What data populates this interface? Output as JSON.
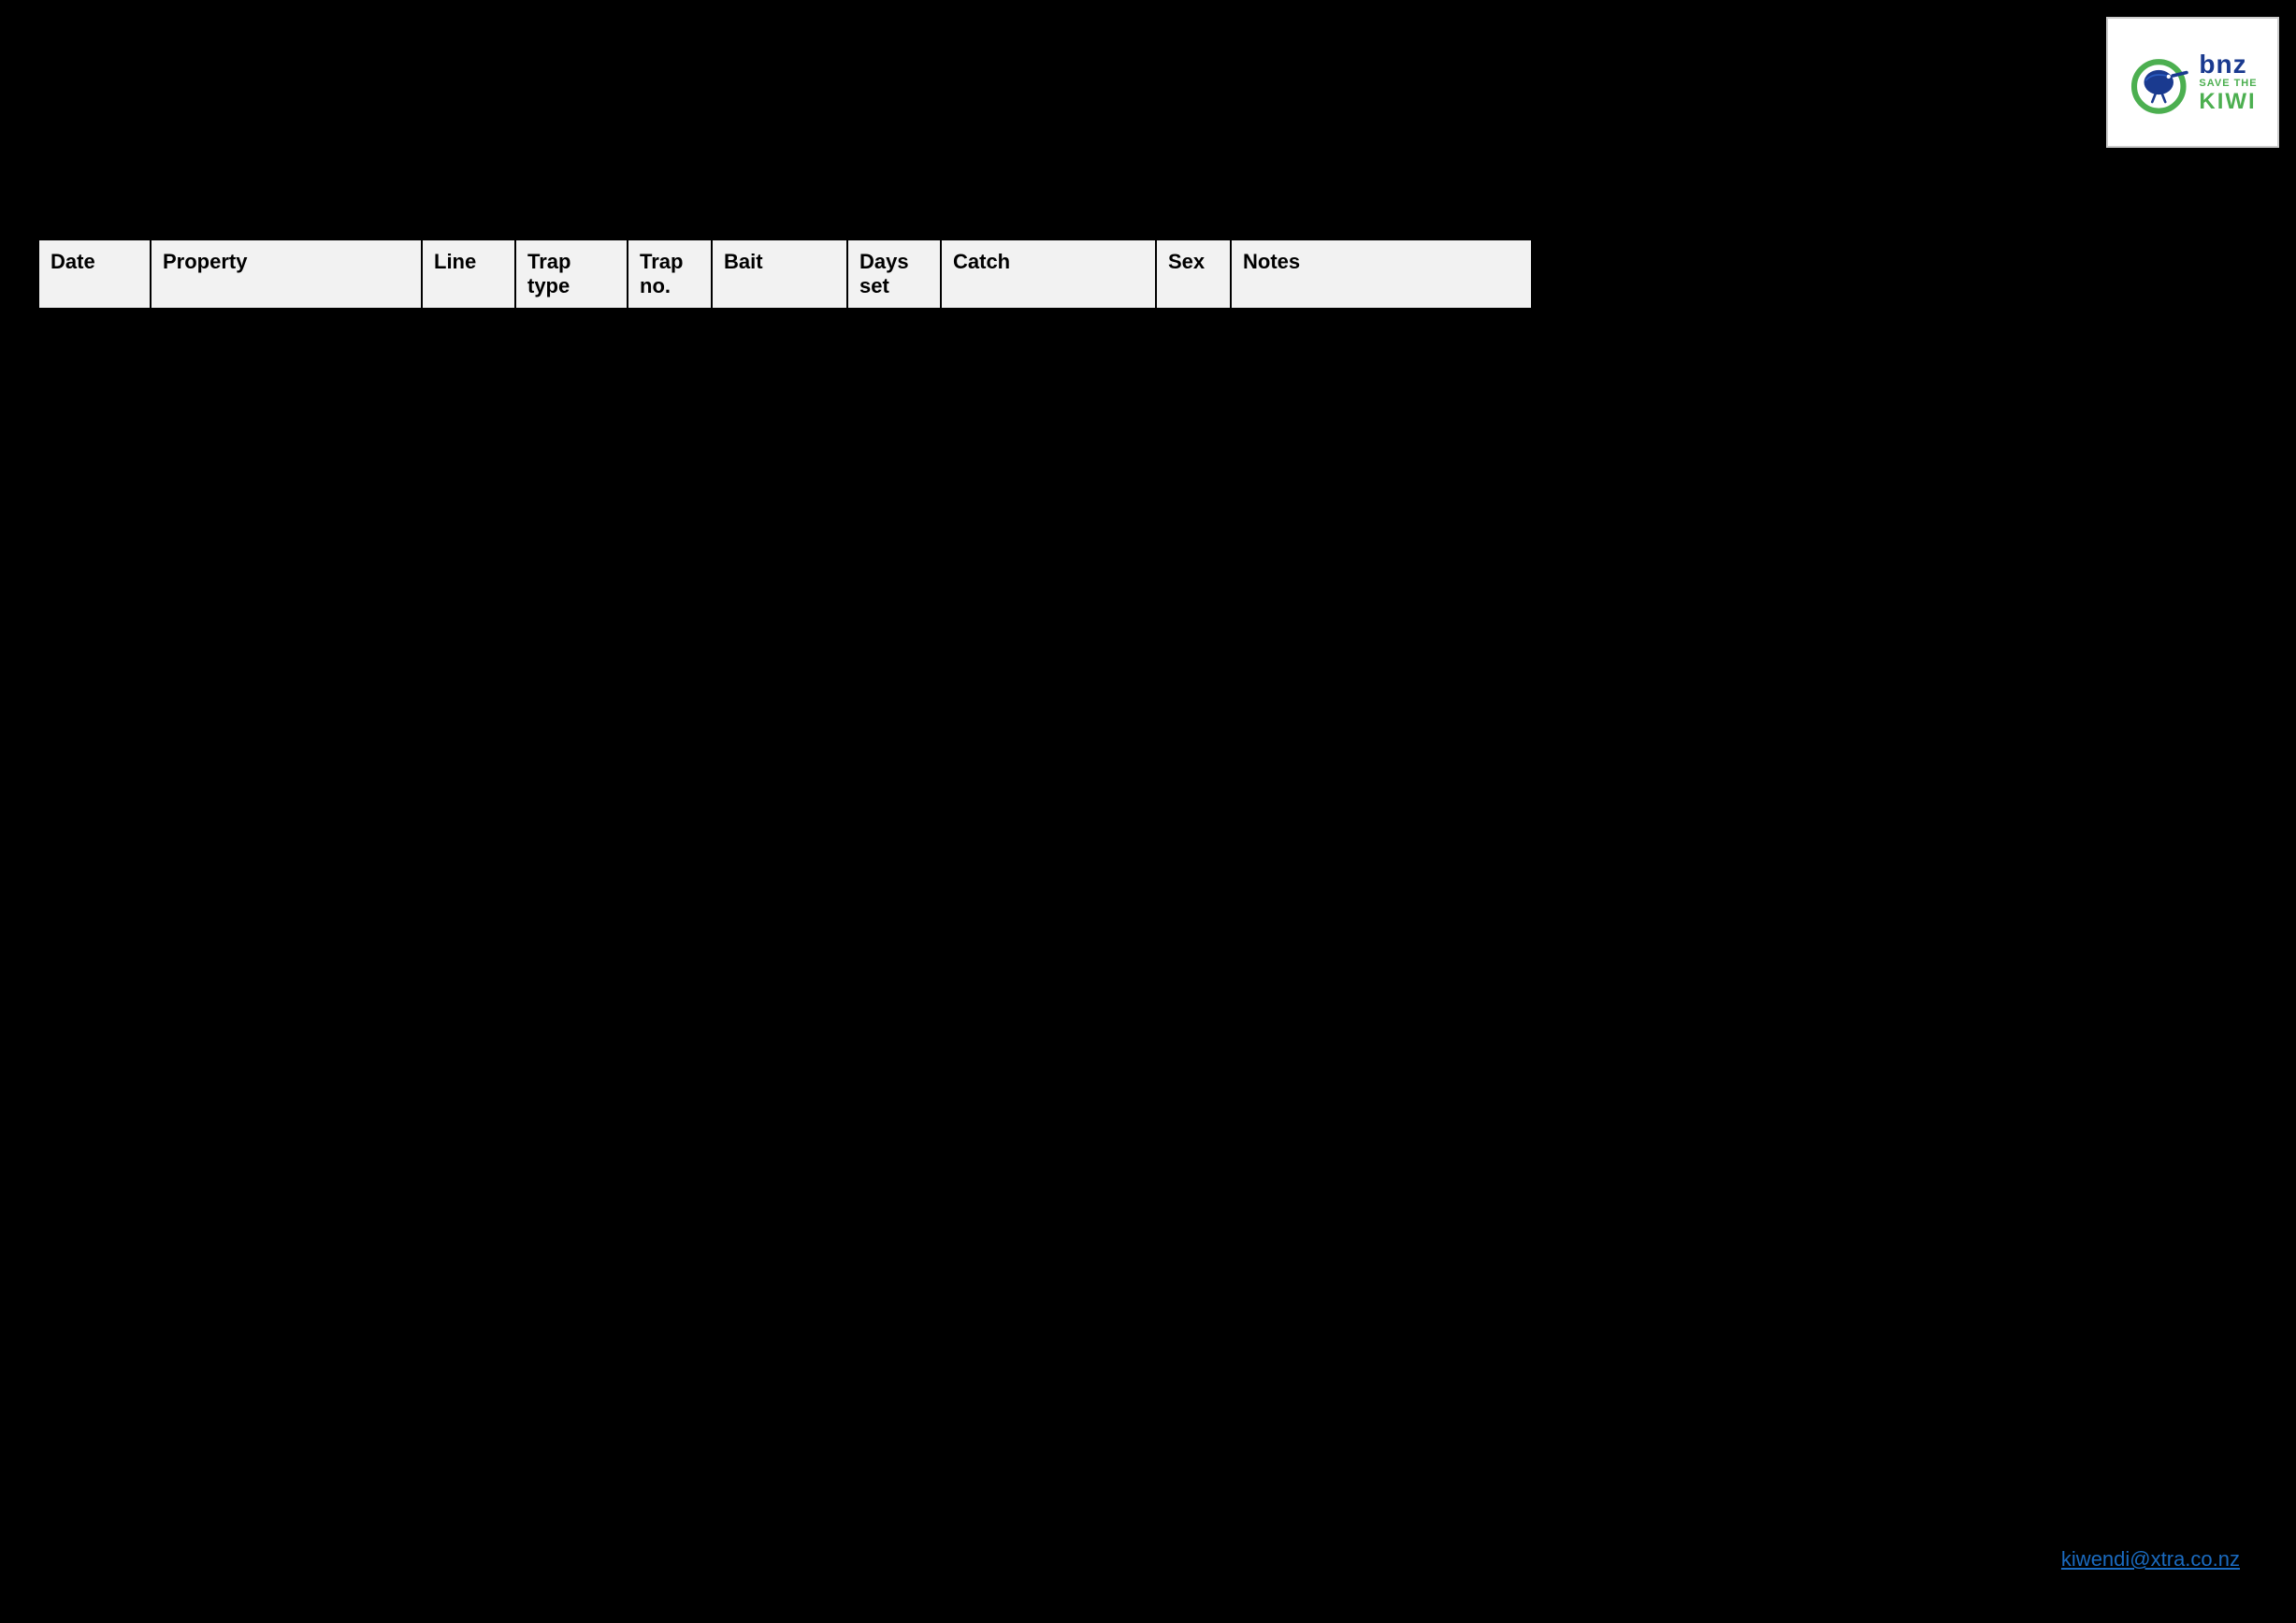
{
  "logo": {
    "alt": "BNZ Save the Kiwi logo",
    "bnz": "bnz",
    "save_the": "SAVE THE",
    "kiwi": "KIWI"
  },
  "table": {
    "headers": [
      {
        "id": "date",
        "label": "Date"
      },
      {
        "id": "property",
        "label": "Property"
      },
      {
        "id": "line",
        "label": "Line"
      },
      {
        "id": "traptype",
        "label": "Trap\ntype"
      },
      {
        "id": "trapno",
        "label": "Trap\nno."
      },
      {
        "id": "bait",
        "label": "Bait"
      },
      {
        "id": "daysset",
        "label": "Days\nset"
      },
      {
        "id": "catch",
        "label": "Catch"
      },
      {
        "id": "sex",
        "label": "Sex"
      },
      {
        "id": "notes",
        "label": "Notes"
      }
    ]
  },
  "footer": {
    "email": "kiwendi@xtra.co.nz"
  }
}
